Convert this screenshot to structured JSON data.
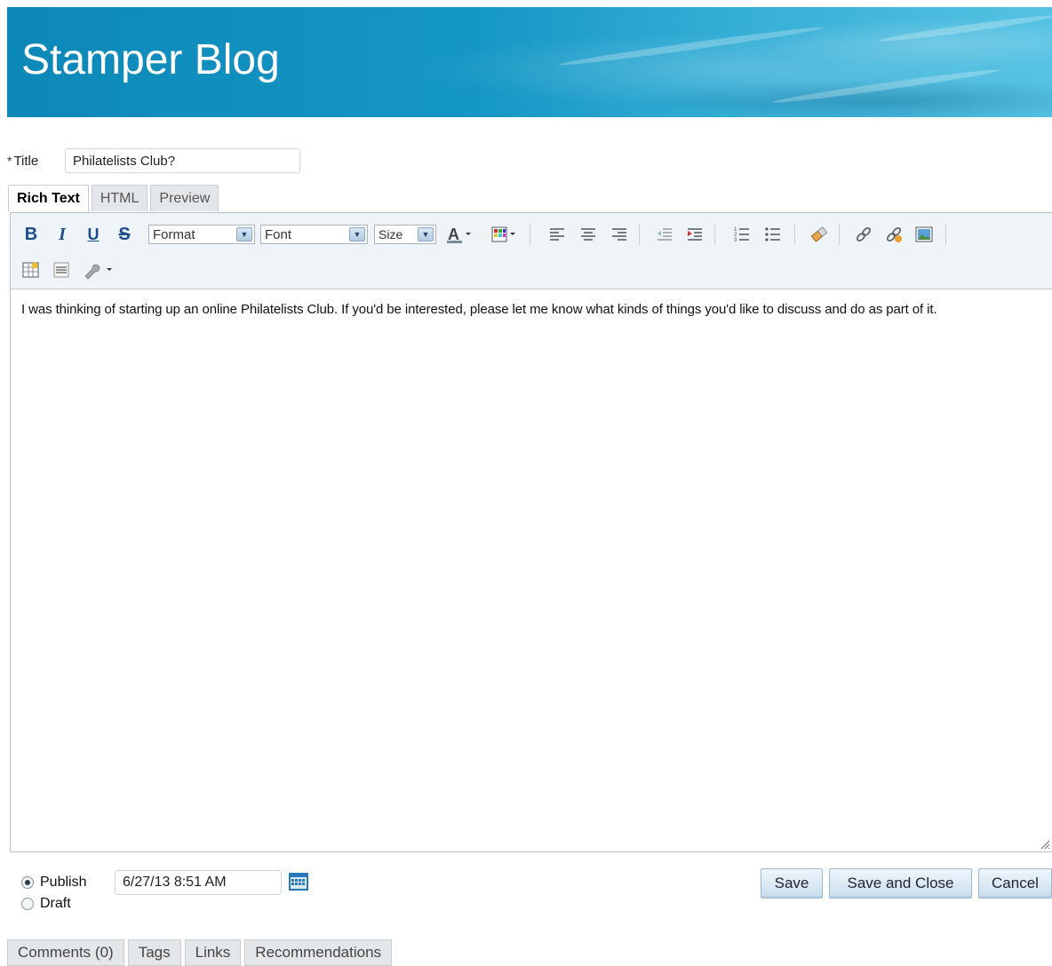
{
  "app": {
    "title": "Stamper Blog"
  },
  "form": {
    "required_marker": "*",
    "title_label": "Title",
    "title_value": "Philatelists Club?"
  },
  "editor_tabs": [
    {
      "label": "Rich Text",
      "active": true
    },
    {
      "label": "HTML",
      "active": false
    },
    {
      "label": "Preview",
      "active": false
    }
  ],
  "toolbar": {
    "bold": "B",
    "italic": "I",
    "underline": "U",
    "strike": "S",
    "format_select": "Format",
    "font_select": "Font",
    "size_select": "Size",
    "icons": [
      "text-color-icon",
      "background-color-icon",
      "align-left-icon",
      "align-center-icon",
      "align-right-icon",
      "outdent-icon",
      "indent-icon",
      "numbered-list-icon",
      "bulleted-list-icon",
      "remove-format-icon",
      "link-icon",
      "unlink-icon",
      "image-icon",
      "insert-table-icon",
      "horizontal-rule-icon",
      "tools-icon"
    ]
  },
  "content": {
    "text": "I was thinking of starting up an online Philatelists Club. If you'd be interested, please let me know what kinds of things you'd like to discuss and do as part of it."
  },
  "publish": {
    "publish_label": "Publish",
    "draft_label": "Draft",
    "selected": "Publish",
    "date_value": "6/27/13 8:51 AM"
  },
  "actions": {
    "save": "Save",
    "save_close": "Save and Close",
    "cancel": "Cancel"
  },
  "bottom_tabs": [
    "Comments (0)",
    "Tags",
    "Links",
    "Recommendations"
  ],
  "colors": {
    "banner": "#1597c5",
    "toolbar_bg": "#eef4f7",
    "icon_blue": "#1e4c8c"
  }
}
